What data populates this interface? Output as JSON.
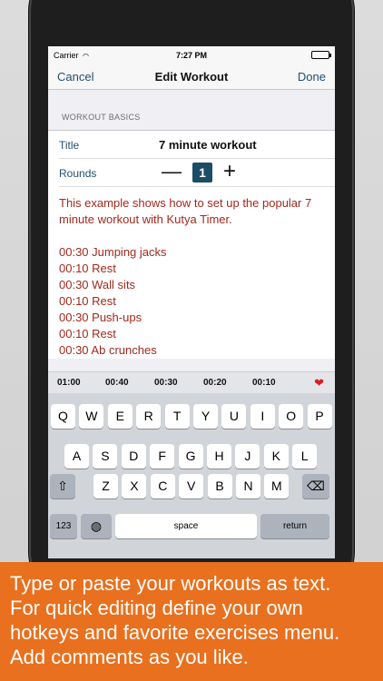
{
  "status_bar": {
    "carrier": "Carrier",
    "wifi_icon": "wifi-icon",
    "time": "7:27 PM"
  },
  "nav": {
    "cancel": "Cancel",
    "title": "Edit Workout",
    "done": "Done"
  },
  "section": {
    "header": "WORKOUT BASICS"
  },
  "fields": {
    "title_label": "Title",
    "title_value": "7 minute workout",
    "rounds_label": "Rounds",
    "rounds_minus": "—",
    "rounds_value": "1",
    "rounds_plus": "+"
  },
  "notes": {
    "intro": "This example shows how to set up the popular 7 minute workout with Kutya Timer.",
    "lines": [
      "00:30 Jumping jacks",
      "00:10 Rest",
      "00:30 Wall sits",
      "00:10 Rest",
      "00:30 Push-ups",
      "00:10 Rest",
      "00:30 Ab crunches"
    ]
  },
  "hotkeys": {
    "items": [
      "01:00",
      "00:40",
      "00:30",
      "00:20",
      "00:10"
    ],
    "favorite_icon": "heart-icon"
  },
  "keyboard": {
    "row1": [
      "Q",
      "W",
      "E",
      "R",
      "T",
      "Y",
      "U",
      "I",
      "O",
      "P"
    ],
    "row2": [
      "A",
      "S",
      "D",
      "F",
      "G",
      "H",
      "J",
      "K",
      "L"
    ],
    "row3": [
      "Z",
      "X",
      "C",
      "V",
      "B",
      "N",
      "M"
    ],
    "numbers_key": "123",
    "space_key": "space",
    "return_key": "return"
  },
  "caption": {
    "line1": "Type or paste your workouts as text.",
    "line2": "For quick editing define your own",
    "line3": "hotkeys and favorite exercises menu.",
    "line4": "Add comments as you like."
  },
  "colors": {
    "accent": "#1c4d67",
    "note_text": "#a0291e",
    "caption_bg": "#e8701e",
    "heart": "#d91d26"
  }
}
